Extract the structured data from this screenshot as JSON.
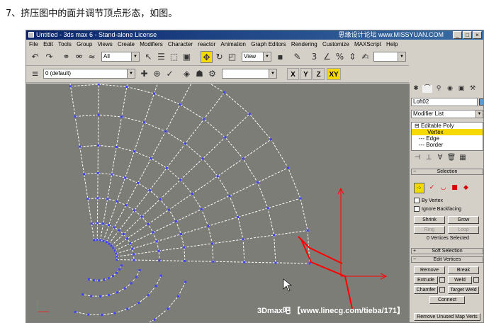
{
  "caption": "7、挤压图中的面并调节顶点形态，如图。",
  "window": {
    "title": "Untitled - 3ds max 6 - Stand-alone License",
    "watermark": "思缘设计论坛 www.MISSYUAN.COM",
    "buttons": [
      "_",
      "□",
      "×"
    ]
  },
  "menu": [
    "File",
    "Edit",
    "Tools",
    "Group",
    "Views",
    "Create",
    "Modifiers",
    "Character",
    "reactor",
    "Animation",
    "Graph Editors",
    "Rendering",
    "Customize",
    "MAXScript",
    "Help"
  ],
  "toolbar1": {
    "selection_filter": "All",
    "reference_coord": "View",
    "named_selection": ""
  },
  "toolbar2": {
    "layer": "0 (default)",
    "second_combo": "",
    "axis": [
      "X",
      "Y",
      "Z",
      "XY"
    ]
  },
  "viewport": {
    "label": "",
    "branding": "3Dmax吧 【www.linecg.com/tieba/171】"
  },
  "panel": {
    "object_name": "Loft02",
    "modifier_list": "Modifier List",
    "stack": [
      {
        "label": "Editable Poly",
        "prefix": "⊟"
      },
      {
        "label": "Vertex",
        "prefix": "",
        "highlight": true
      },
      {
        "label": "Edge",
        "prefix": "---"
      },
      {
        "label": "Border",
        "prefix": "---"
      }
    ],
    "rollouts": {
      "selection": "Selection",
      "soft_selection": "Soft Selection",
      "edit_vertices": "Edit Vertices"
    },
    "checkboxes": {
      "by_vertex": "By Vertex",
      "ignore_backfacing": "Ignore Backfacing"
    },
    "buttons": {
      "shrink": "Shrink",
      "grow": "Grow",
      "ring": "Ring",
      "loop": "Loop",
      "remove": "Remove",
      "break": "Break",
      "extrude": "Extrude",
      "weld": "Weld",
      "chamfer": "Chamfer",
      "target_weld": "Target Weld",
      "connect": "Connect",
      "remove_unused": "Remove Unused Map Verts"
    },
    "selection_status": "0 Vertices Selected"
  },
  "colors": {
    "viewport_bg": "#7d7d78",
    "wire": "#ffffff",
    "vertex": "#4040ff",
    "gizmo": "#ff0000",
    "highlight": "#f5d900"
  }
}
